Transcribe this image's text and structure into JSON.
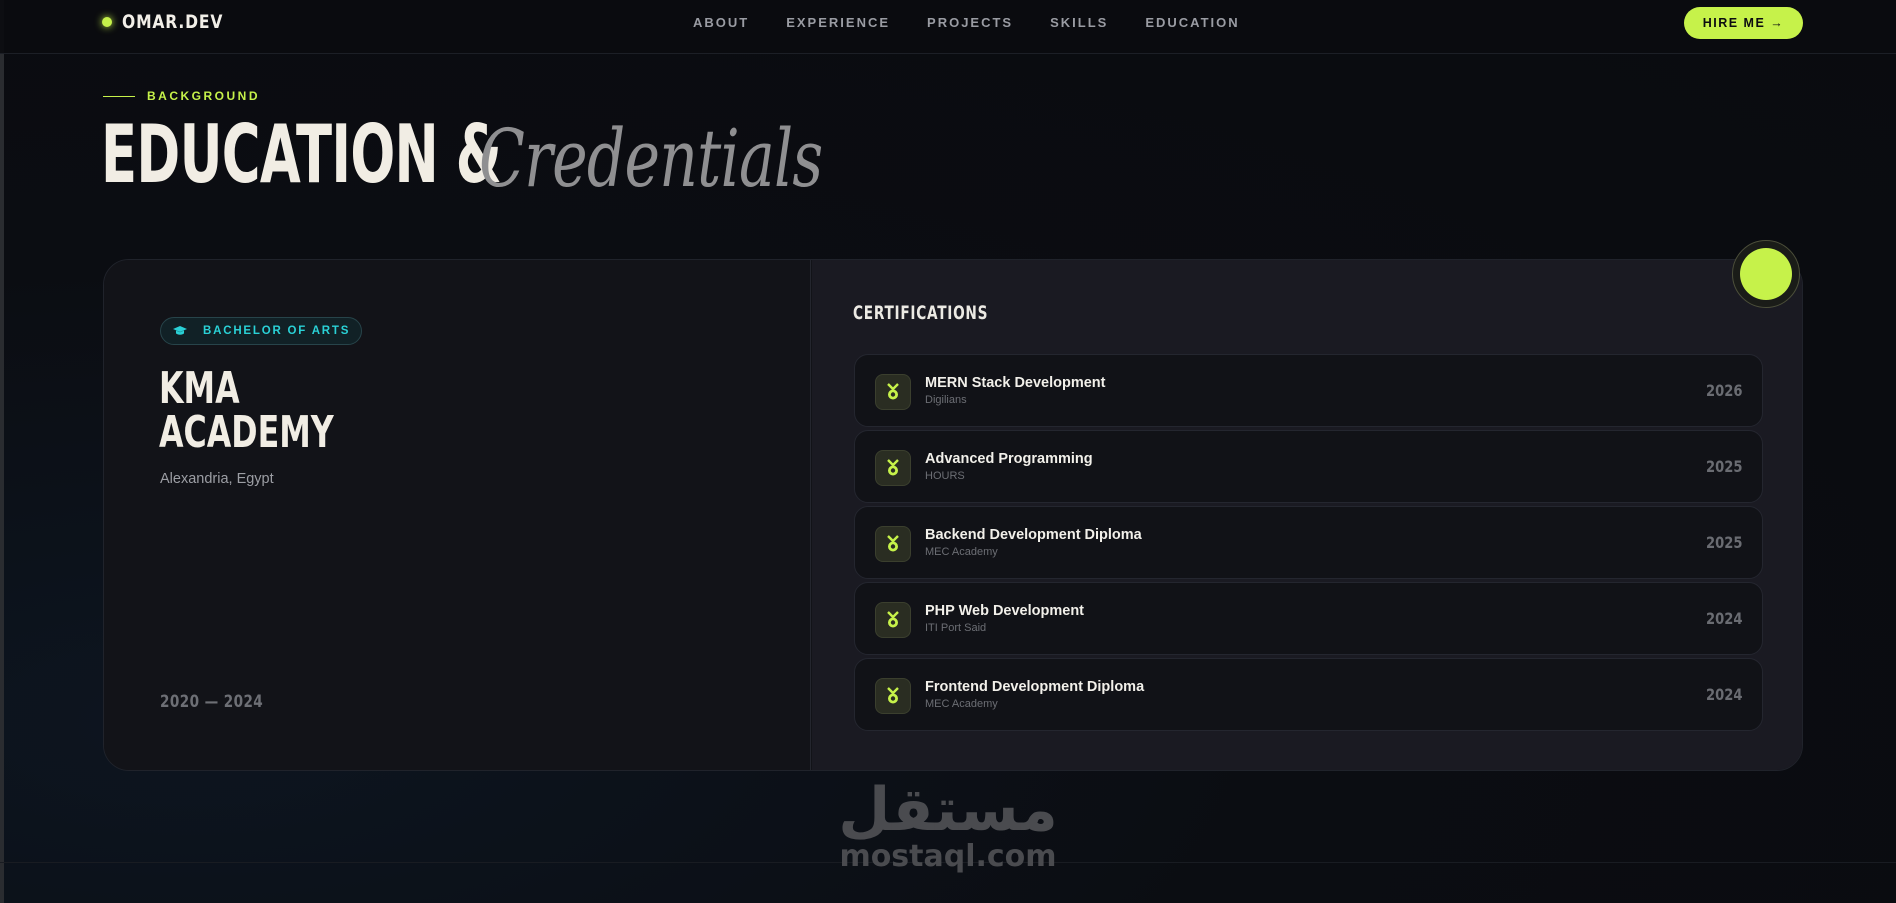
{
  "nav": {
    "logo": "OMAR.DEV",
    "links": [
      "ABOUT",
      "EXPERIENCE",
      "PROJECTS",
      "SKILLS",
      "EDUCATION"
    ],
    "cta": "HIRE ME →"
  },
  "header": {
    "eyebrow": "BACKGROUND",
    "title_bold": "EDUCATION &",
    "title_italic": "Credentials"
  },
  "education": {
    "degree": "BACHELOR OF ARTS",
    "school_line1": "KMA",
    "school_line2": "ACADEMY",
    "location": "Alexandria, Egypt",
    "years": "2020 — 2024"
  },
  "certifications": {
    "title": "CERTIFICATIONS",
    "items": [
      {
        "name": "MERN Stack Development",
        "org": "Digilians",
        "year": "2026"
      },
      {
        "name": "Advanced Programming",
        "org": "HOURS",
        "year": "2025"
      },
      {
        "name": "Backend Development Diploma",
        "org": "MEC Academy",
        "year": "2025"
      },
      {
        "name": "PHP Web Development",
        "org": "ITI Port Said",
        "year": "2024"
      },
      {
        "name": "Frontend Development Diploma",
        "org": "MEC Academy",
        "year": "2024"
      }
    ]
  },
  "watermark": {
    "arabic": "مستقل",
    "latin": "mostaql.com"
  },
  "colors": {
    "accent": "#c6f24a",
    "teal": "#2ad1d6",
    "background": "#0a0b0f"
  },
  "icons": {
    "degree": "graduation-cap-icon",
    "certification": "medal-icon"
  }
}
